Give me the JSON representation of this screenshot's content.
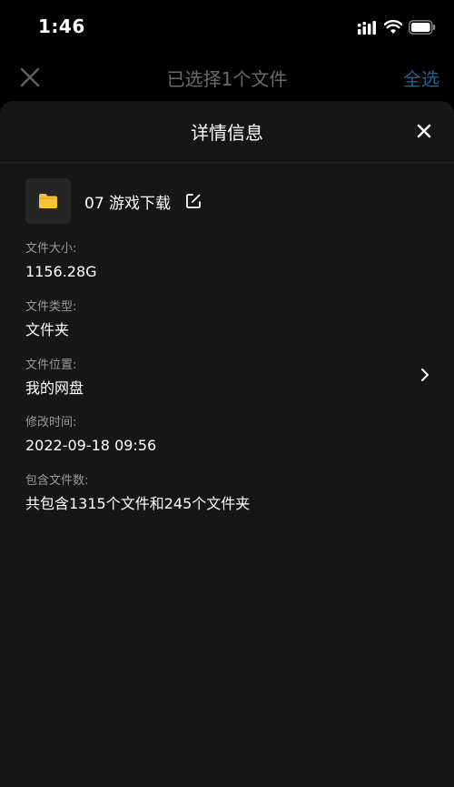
{
  "status_bar": {
    "time": "1:46"
  },
  "background_header": {
    "title": "已选择1个文件",
    "select_all_label": "全选",
    "colors": {
      "select_all": "#2a5f86",
      "title": "#6a6a6a"
    }
  },
  "sheet": {
    "title": "详情信息",
    "file": {
      "name": "07 游戏下载",
      "icon": "folder-icon",
      "folder_color": "#f7c23c"
    },
    "details": [
      {
        "label": "文件大小:",
        "value": "1156.28G"
      },
      {
        "label": "文件类型:",
        "value": "文件夹"
      },
      {
        "label": "文件位置:",
        "value": "我的网盘"
      },
      {
        "label": "修改时间:",
        "value": "2022-09-18 09:56"
      },
      {
        "label": "包含文件数:",
        "value": "共包含1315个文件和245个文件夹"
      }
    ]
  }
}
